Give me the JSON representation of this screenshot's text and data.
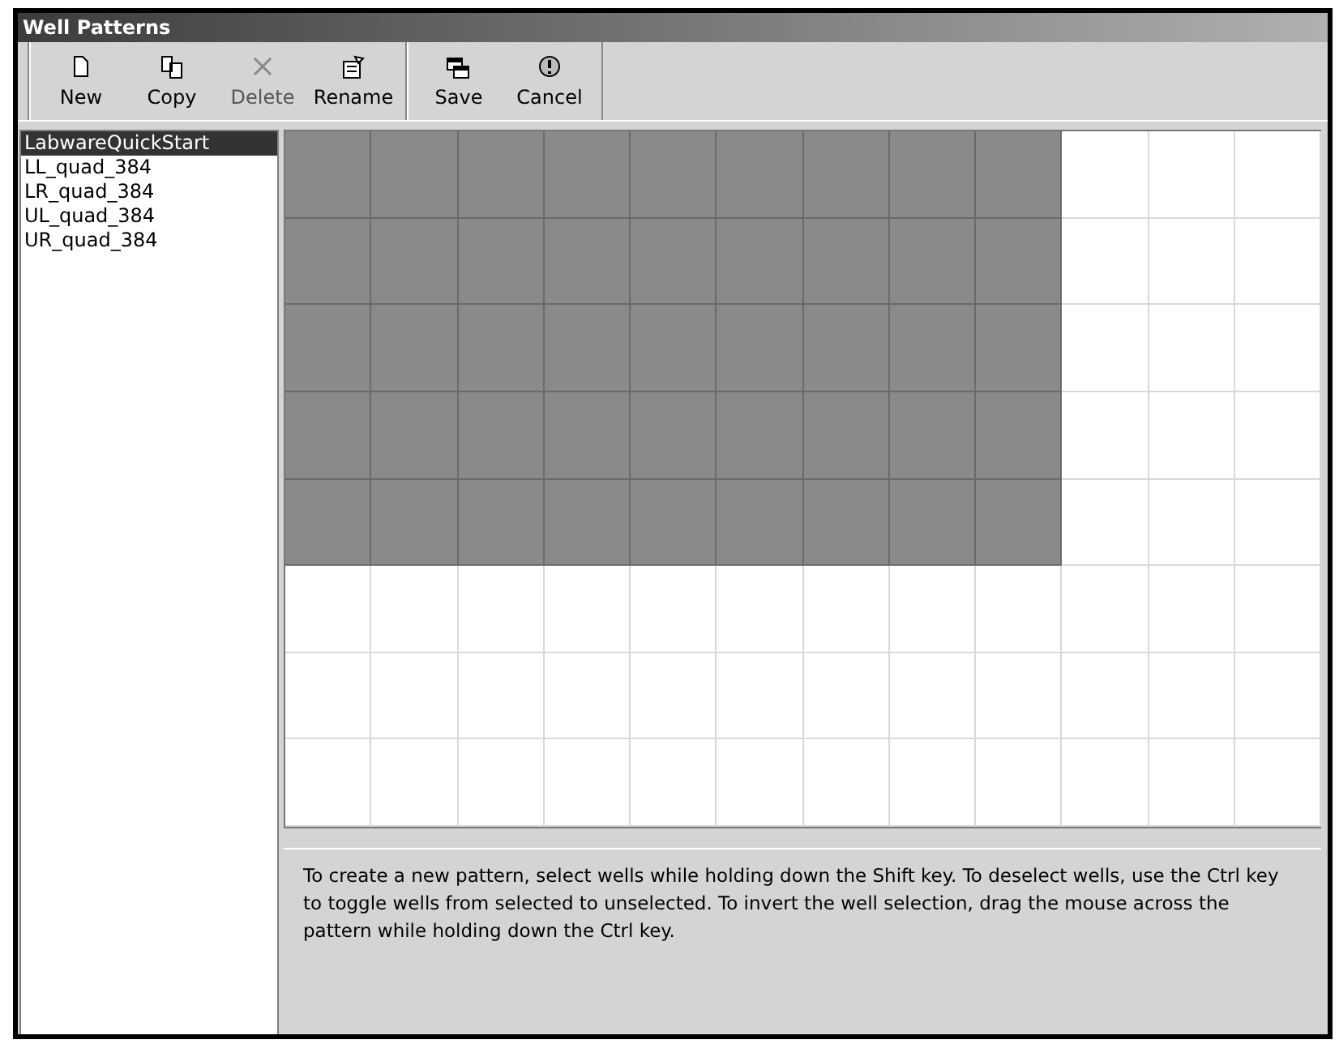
{
  "window": {
    "title": "Well Patterns"
  },
  "toolbar": {
    "groups": [
      [
        {
          "kind": "new",
          "label": "New",
          "disabled": false
        },
        {
          "kind": "copy",
          "label": "Copy",
          "disabled": false
        },
        {
          "kind": "delete",
          "label": "Delete",
          "disabled": true
        },
        {
          "kind": "rename",
          "label": "Rename",
          "disabled": false
        }
      ],
      [
        {
          "kind": "save",
          "label": "Save",
          "disabled": false
        },
        {
          "kind": "cancel",
          "label": "Cancel",
          "disabled": false
        }
      ]
    ]
  },
  "patterns": [
    {
      "name": "LabwareQuickStart",
      "selected": true
    },
    {
      "name": "LL_quad_384",
      "selected": false
    },
    {
      "name": "LR_quad_384",
      "selected": false
    },
    {
      "name": "UL_quad_384",
      "selected": false
    },
    {
      "name": "UR_quad_384",
      "selected": false
    }
  ],
  "wells": [
    [
      {
        "selected": true
      },
      {
        "selected": true
      },
      {
        "selected": true
      },
      {
        "selected": true
      },
      {
        "selected": true
      },
      {
        "selected": true
      },
      {
        "selected": true
      },
      {
        "selected": true
      },
      {
        "selected": true
      },
      {
        "selected": false
      },
      {
        "selected": false
      },
      {
        "selected": false
      }
    ],
    [
      {
        "selected": true
      },
      {
        "selected": true
      },
      {
        "selected": true
      },
      {
        "selected": true
      },
      {
        "selected": true
      },
      {
        "selected": true
      },
      {
        "selected": true
      },
      {
        "selected": true
      },
      {
        "selected": true
      },
      {
        "selected": false
      },
      {
        "selected": false
      },
      {
        "selected": false
      }
    ],
    [
      {
        "selected": true
      },
      {
        "selected": true
      },
      {
        "selected": true
      },
      {
        "selected": true
      },
      {
        "selected": true
      },
      {
        "selected": true
      },
      {
        "selected": true
      },
      {
        "selected": true
      },
      {
        "selected": true
      },
      {
        "selected": false
      },
      {
        "selected": false
      },
      {
        "selected": false
      }
    ],
    [
      {
        "selected": true
      },
      {
        "selected": true
      },
      {
        "selected": true
      },
      {
        "selected": true
      },
      {
        "selected": true
      },
      {
        "selected": true
      },
      {
        "selected": true
      },
      {
        "selected": true
      },
      {
        "selected": true
      },
      {
        "selected": false
      },
      {
        "selected": false
      },
      {
        "selected": false
      }
    ],
    [
      {
        "selected": true
      },
      {
        "selected": true
      },
      {
        "selected": true
      },
      {
        "selected": true
      },
      {
        "selected": true
      },
      {
        "selected": true
      },
      {
        "selected": true
      },
      {
        "selected": true
      },
      {
        "selected": true
      },
      {
        "selected": false
      },
      {
        "selected": false
      },
      {
        "selected": false
      }
    ],
    [
      {
        "selected": false
      },
      {
        "selected": false
      },
      {
        "selected": false
      },
      {
        "selected": false
      },
      {
        "selected": false
      },
      {
        "selected": false
      },
      {
        "selected": false
      },
      {
        "selected": false
      },
      {
        "selected": false
      },
      {
        "selected": false
      },
      {
        "selected": false
      },
      {
        "selected": false
      }
    ],
    [
      {
        "selected": false
      },
      {
        "selected": false
      },
      {
        "selected": false
      },
      {
        "selected": false
      },
      {
        "selected": false
      },
      {
        "selected": false
      },
      {
        "selected": false
      },
      {
        "selected": false
      },
      {
        "selected": false
      },
      {
        "selected": false
      },
      {
        "selected": false
      },
      {
        "selected": false
      }
    ],
    [
      {
        "selected": false
      },
      {
        "selected": false
      },
      {
        "selected": false
      },
      {
        "selected": false
      },
      {
        "selected": false
      },
      {
        "selected": false
      },
      {
        "selected": false
      },
      {
        "selected": false
      },
      {
        "selected": false
      },
      {
        "selected": false
      },
      {
        "selected": false
      },
      {
        "selected": false
      }
    ]
  ],
  "instructions": "To create a new pattern, select wells while holding down the Shift key. To deselect wells, use the Ctrl key to toggle wells from selected to unselected. To invert the well selection, drag the mouse across the pattern while holding down the Ctrl key."
}
